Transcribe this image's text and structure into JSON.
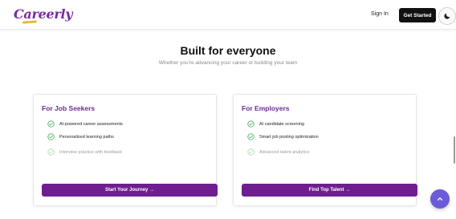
{
  "header": {
    "logo_text": "Careerly",
    "signin_label": "Sign In",
    "get_started_label": "Get Started",
    "theme_toggle_icon": "moon-icon"
  },
  "section": {
    "title": "Built for everyone",
    "subtitle": "Whether you're advancing your career or building your team"
  },
  "cards": [
    {
      "title": "For Job Seekers",
      "features": [
        {
          "label": "AI-powered career assessments",
          "muted": false
        },
        {
          "label": "Personalized learning paths",
          "muted": false
        },
        {
          "label": "Interview practice with feedback",
          "muted": true
        }
      ],
      "button_label": "Start Your Journey →"
    },
    {
      "title": "For Employers",
      "features": [
        {
          "label": "AI candidate screening",
          "muted": false
        },
        {
          "label": "Smart job posting optimization",
          "muted": false
        },
        {
          "label": "Advanced talent analytics",
          "muted": true
        }
      ],
      "button_label": "Find Top Talent →"
    }
  ],
  "colors": {
    "brand_purple": "#6e1e8e",
    "check_green": "#2fa84f",
    "fab_blue": "#6a5bd8"
  },
  "fab_icon": "chevron-up-icon"
}
